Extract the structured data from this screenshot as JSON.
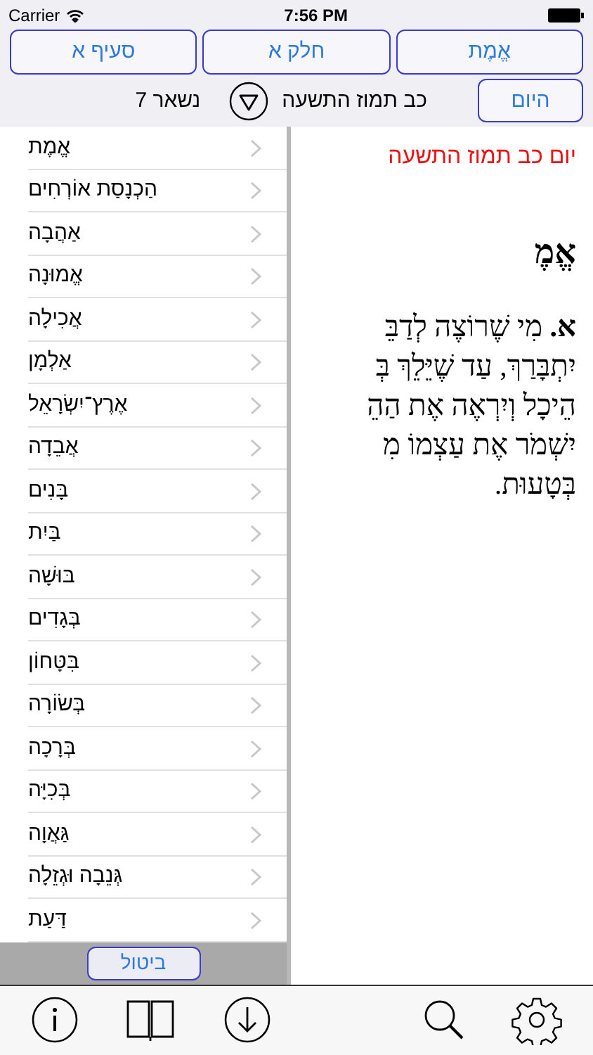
{
  "status_bar": {
    "carrier": "Carrier",
    "time": "7:56 PM"
  },
  "nav_buttons": [
    {
      "label": "אֱמֶת"
    },
    {
      "label": "חלק א"
    },
    {
      "label": "סעיף א"
    }
  ],
  "date_row": {
    "today_button": "היום",
    "date": "כב תמוז התשעה",
    "remaining": "נשאר 7"
  },
  "content": {
    "date_line": "יום כב תמוז התשעה",
    "heading": "אֱמֶ",
    "lines": [
      "**א.** מִי שֶׁרוֹצֶה לְדַבֵּ",
      "יִתְבָּרַךְ, עַד שֶׁיֵּלֵךְ בְּ",
      "הֵיכָל וְיִרְאֶה אֶת הַהֵ",
      "יִשְׁמֹר אֶת עַצְמוֹ מִ",
      "בְּטָעוּת."
    ]
  },
  "drawer": {
    "items": [
      "אֱמֶת",
      "הַכְנָסַת אוֹרְחִים",
      "אַהֲבָה",
      "אֱמוּנָה",
      "אֲכִילָה",
      "אַלְמָן",
      "אֶרֶץ־יִשְׂרָאֵל",
      "אֲבֵדָה",
      "בָּנִים",
      "בַּיִת",
      "בּוּשָׁה",
      "בְּגָדִים",
      "בִּטָּחוֹן",
      "בְּשׂוֹרָה",
      "בְּרָכָה",
      "בְּכִיָּה",
      "גַּאֲוָה",
      "גְּנֵבָה וּגְזֵלָה",
      "דַּעַת"
    ],
    "cancel_button": "ביטול"
  }
}
